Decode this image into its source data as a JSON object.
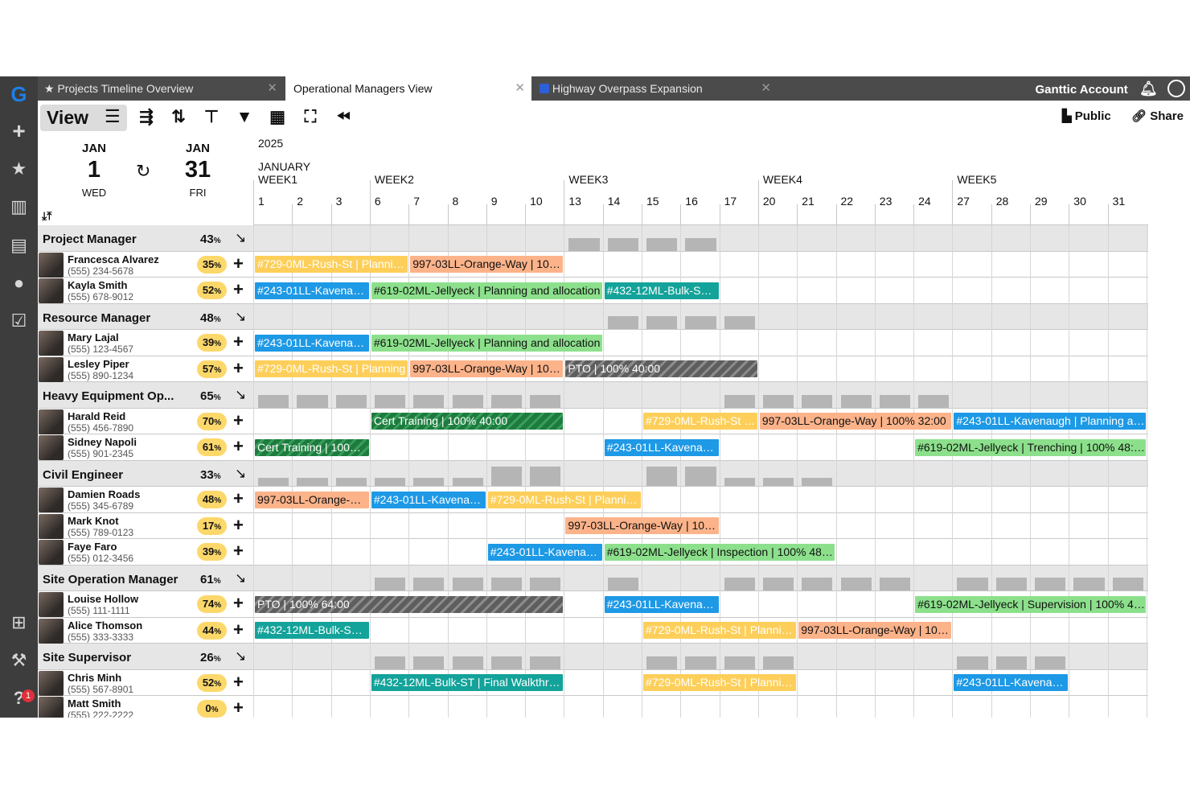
{
  "tabs": [
    {
      "label": "Projects Timeline Overview",
      "icon": "star-icon",
      "active": false
    },
    {
      "label": "Operational Managers View",
      "active": true
    },
    {
      "label": "Highway Overpass Expansion",
      "icon": "folder-icon",
      "active": false
    }
  ],
  "account": {
    "label": "Ganttic Account"
  },
  "sidebar": {
    "badge_count": "1"
  },
  "toolbar": {
    "view_label": "View",
    "public_label": "Public",
    "share_label": "Share"
  },
  "date_range": {
    "start": {
      "month": "JAN",
      "day": "1",
      "weekday": "WED"
    },
    "end": {
      "month": "JAN",
      "day": "31",
      "weekday": "FRI"
    }
  },
  "timeline": {
    "year": "2025",
    "month": "JANUARY",
    "weeks": [
      {
        "label": "WEEK1",
        "start": 1
      },
      {
        "label": "WEEK2",
        "start": 6
      },
      {
        "label": "WEEK3",
        "start": 13
      },
      {
        "label": "WEEK4",
        "start": 20
      },
      {
        "label": "WEEK5",
        "start": 27
      }
    ],
    "days": [
      "1",
      "2",
      "3",
      "6",
      "7",
      "8",
      "9",
      "10",
      "13",
      "14",
      "15",
      "16",
      "17",
      "20",
      "21",
      "22",
      "23",
      "24",
      "27",
      "28",
      "29",
      "30",
      "31"
    ]
  },
  "colors": {
    "yellow": "#fdcf5a",
    "orange": "#fcb38a",
    "blue": "#1d99e6",
    "green": "#8ce08c",
    "teal": "#13a39a",
    "pto": "#5e5e5e",
    "cert": "#1f7a3f",
    "pct_badge": "#fcd86b"
  },
  "rows": [
    {
      "type": "group",
      "name": "Project Manager",
      "pct": "43",
      "util": [
        0,
        0,
        0,
        0,
        0,
        0,
        0,
        0,
        16,
        16,
        16,
        16,
        0,
        0,
        0,
        0,
        0,
        0,
        0,
        0,
        0,
        0,
        0
      ]
    },
    {
      "type": "person",
      "name": "Francesca Alvarez",
      "phone": "(555) 234-5678",
      "pct": "35",
      "bars": [
        {
          "s": 0,
          "e": 4,
          "c": "yellow",
          "t": "#729-0ML-Rush-St | Planning and allocation"
        },
        {
          "s": 4,
          "e": 8,
          "c": "orange",
          "t": "997-03LL-Orange-Way | 100% 40:00"
        }
      ]
    },
    {
      "type": "person",
      "name": "Kayla Smith",
      "phone": "(555) 678-9012",
      "pct": "52",
      "bars": [
        {
          "s": 0,
          "e": 3,
          "c": "blue",
          "t": "#243-01LL-Kavenaugh | Planning"
        },
        {
          "s": 3,
          "e": 9,
          "c": "green",
          "t": "#619-02ML-Jellyeck | Planning and allocation"
        },
        {
          "s": 9,
          "e": 12,
          "c": "teal",
          "t": "#432-12ML-Bulk-ST | Final"
        }
      ]
    },
    {
      "type": "group",
      "name": "Resource Manager",
      "pct": "48",
      "util": [
        0,
        0,
        0,
        0,
        0,
        0,
        0,
        0,
        0,
        16,
        16,
        16,
        16,
        0,
        0,
        0,
        0,
        0,
        0,
        0,
        0,
        0,
        0
      ]
    },
    {
      "type": "person",
      "name": "Mary Lajal",
      "phone": "(555) 123-4567",
      "pct": "39",
      "bars": [
        {
          "s": 0,
          "e": 3,
          "c": "blue",
          "t": "#243-01LL-Kavenaugh | Planning"
        },
        {
          "s": 3,
          "e": 9,
          "c": "green",
          "t": "#619-02ML-Jellyeck | Planning and allocation"
        }
      ]
    },
    {
      "type": "person",
      "name": "Lesley Piper",
      "phone": "(555) 890-1234",
      "pct": "57",
      "bars": [
        {
          "s": 0,
          "e": 4,
          "c": "yellow",
          "t": "#729-0ML-Rush-St | Planning"
        },
        {
          "s": 4,
          "e": 8,
          "c": "orange",
          "t": "997-03LL-Orange-Way | 100% 40:00"
        },
        {
          "s": 8,
          "e": 13,
          "c": "pto",
          "t": "PTO | 100% 40:00"
        }
      ]
    },
    {
      "type": "group",
      "name": "Heavy Equipment Operator",
      "pct": "65",
      "util": [
        16,
        16,
        16,
        16,
        16,
        16,
        16,
        16,
        0,
        0,
        0,
        0,
        16,
        16,
        16,
        16,
        16,
        16,
        0,
        0,
        0,
        0,
        0
      ]
    },
    {
      "type": "person",
      "name": "Harald Reid",
      "phone": "(555) 456-7890",
      "pct": "70",
      "bars": [
        {
          "s": 3,
          "e": 8,
          "c": "cert",
          "t": "Cert Training | 100% 40:00"
        },
        {
          "s": 10,
          "e": 13,
          "c": "yellow",
          "t": "#729-0ML-Rush-St | Planning"
        },
        {
          "s": 13,
          "e": 18,
          "c": "orange",
          "t": "997-03LL-Orange-Way | 100% 32:00"
        },
        {
          "s": 18,
          "e": 23,
          "c": "blue",
          "t": "#243-01LL-Kavenaugh | Planning and allocation"
        }
      ]
    },
    {
      "type": "person",
      "name": "Sidney Napoli",
      "phone": "(555) 901-2345",
      "pct": "61",
      "bars": [
        {
          "s": 0,
          "e": 3,
          "c": "cert",
          "t": "Cert Training | 100% 24:00"
        },
        {
          "s": 9,
          "e": 12,
          "c": "blue",
          "t": "#243-01LL-Kavenaugh | Site"
        },
        {
          "s": 17,
          "e": 23,
          "c": "green",
          "t": "#619-02ML-Jellyeck | Trenching | 100% 48:00"
        }
      ]
    },
    {
      "type": "group",
      "name": "Civil Engineer",
      "pct": "33",
      "util": [
        10,
        10,
        10,
        10,
        10,
        10,
        24,
        24,
        0,
        0,
        24,
        24,
        10,
        10,
        10,
        0,
        0,
        0,
        0,
        0,
        0,
        0,
        0
      ]
    },
    {
      "type": "person",
      "name": "Damien Roads",
      "phone": "(555) 345-6789",
      "pct": "48",
      "bars": [
        {
          "s": 0,
          "e": 3,
          "c": "orange",
          "t": "997-03LL-Orange-Way | 100%"
        },
        {
          "s": 3,
          "e": 6,
          "c": "blue",
          "t": "#243-01LL-Kavenaugh | Planning"
        },
        {
          "s": 6,
          "e": 10,
          "c": "yellow",
          "t": "#729-0ML-Rush-St | Planning and allocation"
        }
      ]
    },
    {
      "type": "person",
      "name": "Mark Knot",
      "phone": "(555) 789-0123",
      "pct": "17",
      "bars": [
        {
          "s": 8,
          "e": 12,
          "c": "orange",
          "t": "997-03LL-Orange-Way | 100% 32:00"
        }
      ]
    },
    {
      "type": "person",
      "name": "Faye Faro",
      "phone": "(555) 012-3456",
      "pct": "39",
      "bars": [
        {
          "s": 6,
          "e": 9,
          "c": "blue",
          "t": "#243-01LL-Kavenaugh | Site"
        },
        {
          "s": 9,
          "e": 15,
          "c": "green",
          "t": "#619-02ML-Jellyeck | Inspection | 100% 48:00"
        }
      ]
    },
    {
      "type": "group",
      "name": "Site Operation Manager",
      "pct": "61",
      "util": [
        0,
        0,
        0,
        16,
        16,
        16,
        16,
        16,
        0,
        16,
        0,
        0,
        16,
        16,
        16,
        16,
        16,
        0,
        16,
        16,
        16,
        16,
        16
      ]
    },
    {
      "type": "person",
      "name": "Louise Hollow",
      "phone": "(555) 111-1111",
      "pct": "74",
      "bars": [
        {
          "s": 0,
          "e": 8,
          "c": "pto",
          "t": "PTO | 100% 64:00"
        },
        {
          "s": 9,
          "e": 12,
          "c": "blue",
          "t": "#243-01LL-Kavenaugh | Site"
        },
        {
          "s": 17,
          "e": 23,
          "c": "green",
          "t": "#619-02ML-Jellyeck | Supervision | 100% 48:00"
        }
      ]
    },
    {
      "type": "person",
      "name": "Alice Thomson",
      "phone": "(555) 333-3333",
      "pct": "44",
      "bars": [
        {
          "s": 0,
          "e": 3,
          "c": "teal",
          "t": "#432-12ML-Bulk-ST | Planning"
        },
        {
          "s": 10,
          "e": 14,
          "c": "yellow",
          "t": "#729-0ML-Rush-St | Planning and allocation"
        },
        {
          "s": 14,
          "e": 18,
          "c": "orange",
          "t": "997-03LL-Orange-Way | 100% 32:00"
        }
      ]
    },
    {
      "type": "group",
      "name": "Site Supervisor",
      "pct": "26",
      "util": [
        0,
        0,
        0,
        16,
        16,
        16,
        16,
        16,
        0,
        0,
        16,
        16,
        16,
        16,
        0,
        0,
        0,
        0,
        16,
        16,
        16,
        0,
        0
      ]
    },
    {
      "type": "person",
      "name": "Chris Minh",
      "phone": "(555) 567-8901",
      "pct": "52",
      "bars": [
        {
          "s": 3,
          "e": 8,
          "c": "teal",
          "t": "#432-12ML-Bulk-ST | Final Walkthrough"
        },
        {
          "s": 10,
          "e": 14,
          "c": "yellow",
          "t": "#729-0ML-Rush-St | Planning and allocation"
        },
        {
          "s": 18,
          "e": 21,
          "c": "blue",
          "t": "#243-01LL-Kavenaugh | Site"
        }
      ]
    },
    {
      "type": "person",
      "name": "Matt Smith",
      "phone": "(555) 222-2222",
      "pct": "0",
      "bars": []
    }
  ]
}
